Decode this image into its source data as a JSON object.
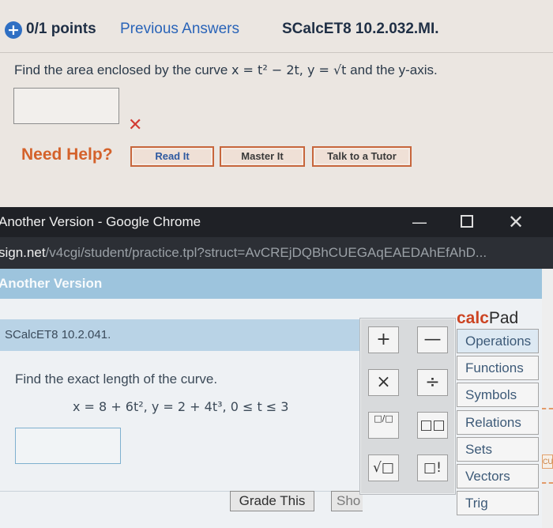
{
  "question_page": {
    "points_icon": "+",
    "points": "0/1 points",
    "previous_answers": "Previous Answers",
    "question_id": "SCalcET8 10.2.032.MI.",
    "question_text_start": "Find the area enclosed by the curve ",
    "equation": "x = t² − 2t, y = √t",
    "question_text_end": " and the y-axis.",
    "answer_value": "",
    "result_mark": "✕",
    "need_help": "Need Help?",
    "buttons": {
      "read": "Read It",
      "master": "Master It",
      "tutor": "Talk to a Tutor"
    }
  },
  "popup": {
    "window_title": "Another Version - Google Chrome",
    "controls": {
      "minimize": "—",
      "close": "✕"
    },
    "url_domain": "sign.net",
    "url_path": "/v4cgi/student/practice.tpl?struct=AvCREjDQBhCUEGAqEAEDAhEfAhD...",
    "header": "Another Version",
    "question_id": "SCalcET8 10.2.041.",
    "question_text": "Find the exact length of the curve.",
    "equation": "x = 8 + 6t²,   y = 2 + 4t³,   0 ≤ t ≤ 3",
    "answer_value": "",
    "grade_button": "Grade This",
    "show_button": "Sho"
  },
  "calcpad": {
    "title_calc": "calc",
    "title_pad": "Pad",
    "keys": [
      "+",
      "—",
      "×",
      "÷",
      "□/□",
      "□□",
      "√□",
      "□!"
    ],
    "categories": [
      "Operations",
      "Functions",
      "Symbols",
      "Relations",
      "Sets",
      "Vectors",
      "Trig"
    ],
    "side_text": "CU"
  },
  "colors": {
    "accent_blue": "#2f6fc3",
    "error_red": "#d23b33",
    "help_orange": "#d4622b",
    "calc_red": "#cc4422"
  }
}
